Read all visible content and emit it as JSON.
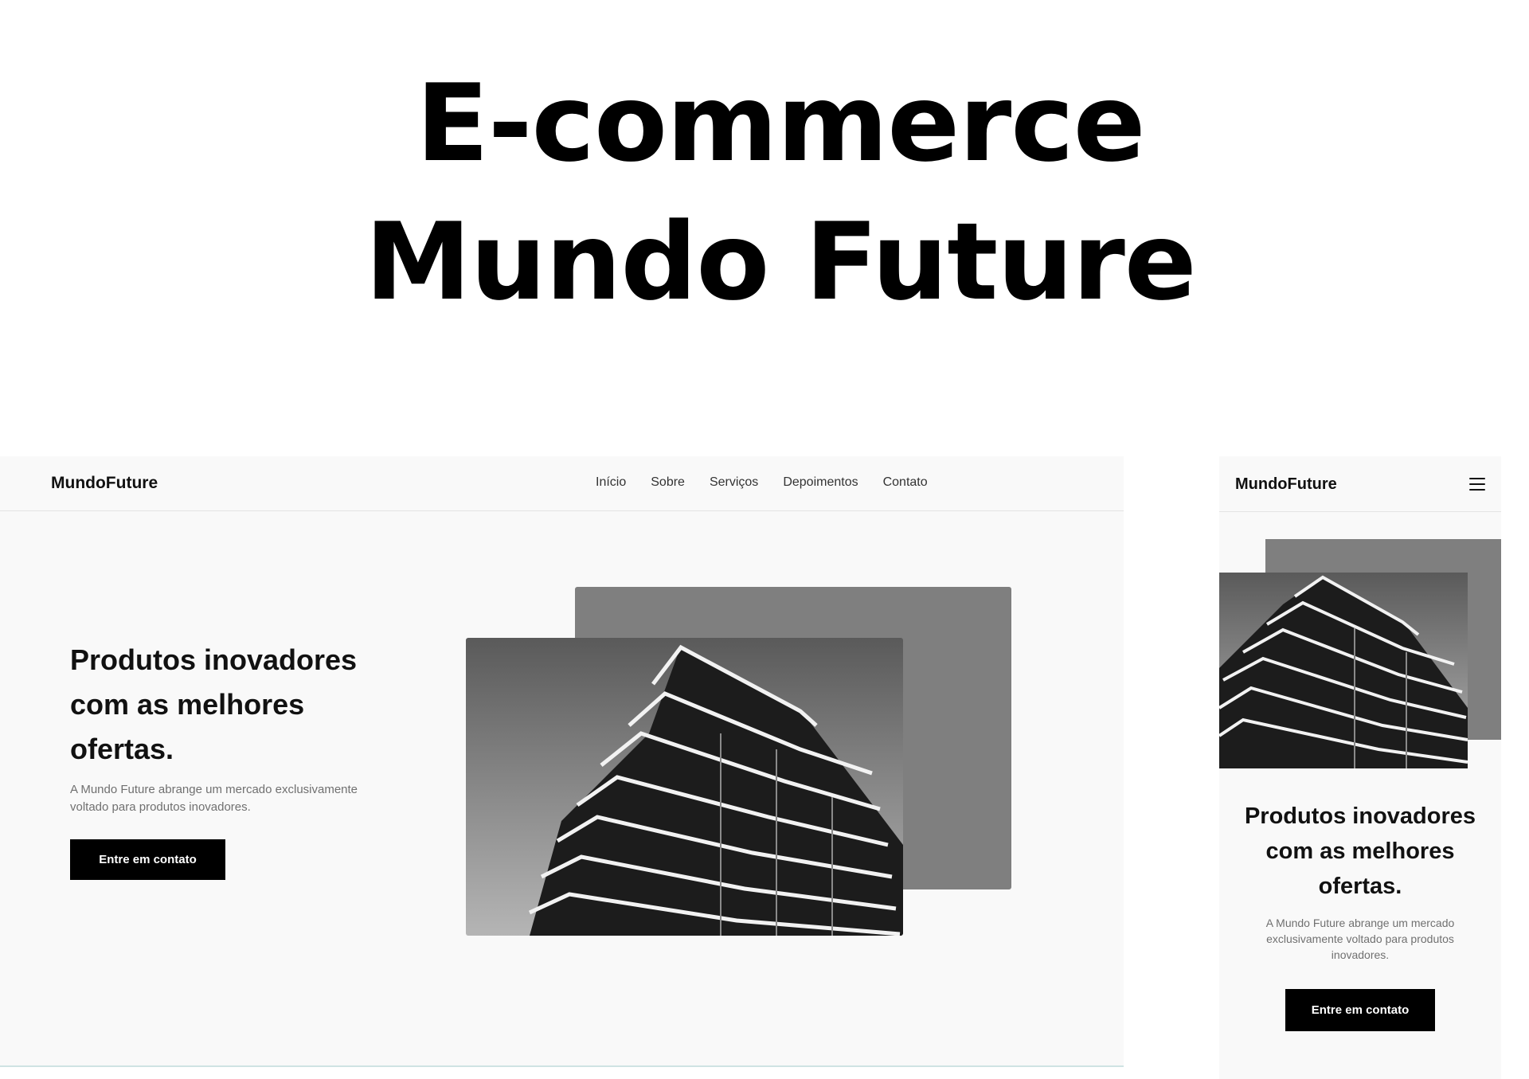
{
  "headline": {
    "line1": "E-commerce",
    "line2": "Mundo Future"
  },
  "desktop": {
    "logo": "MundoFuture",
    "nav": [
      "Início",
      "Sobre",
      "Serviços",
      "Depoimentos",
      "Contato"
    ],
    "hero_title": "Produtos inovadores com as melhores ofertas.",
    "hero_description": "A Mundo Future abrange um mercado exclusivamente voltado para produtos inovadores.",
    "cta_label": "Entre em contato",
    "image_icon": "building-photo"
  },
  "mobile": {
    "logo": "MundoFuture",
    "menu_icon": "hamburger-menu-icon",
    "hero_title": "Produtos inovadores com as melhores ofertas.",
    "hero_description": "A Mundo Future abrange um mercado exclusivamente voltado para produtos inovadores.",
    "cta_label": "Entre em contato",
    "image_icon": "building-photo"
  },
  "colors": {
    "page_background": "#ffffff",
    "site_background": "#f9f9f9",
    "accent_gray": "#7f7f7f",
    "button": "#000000",
    "button_text": "#ffffff"
  }
}
